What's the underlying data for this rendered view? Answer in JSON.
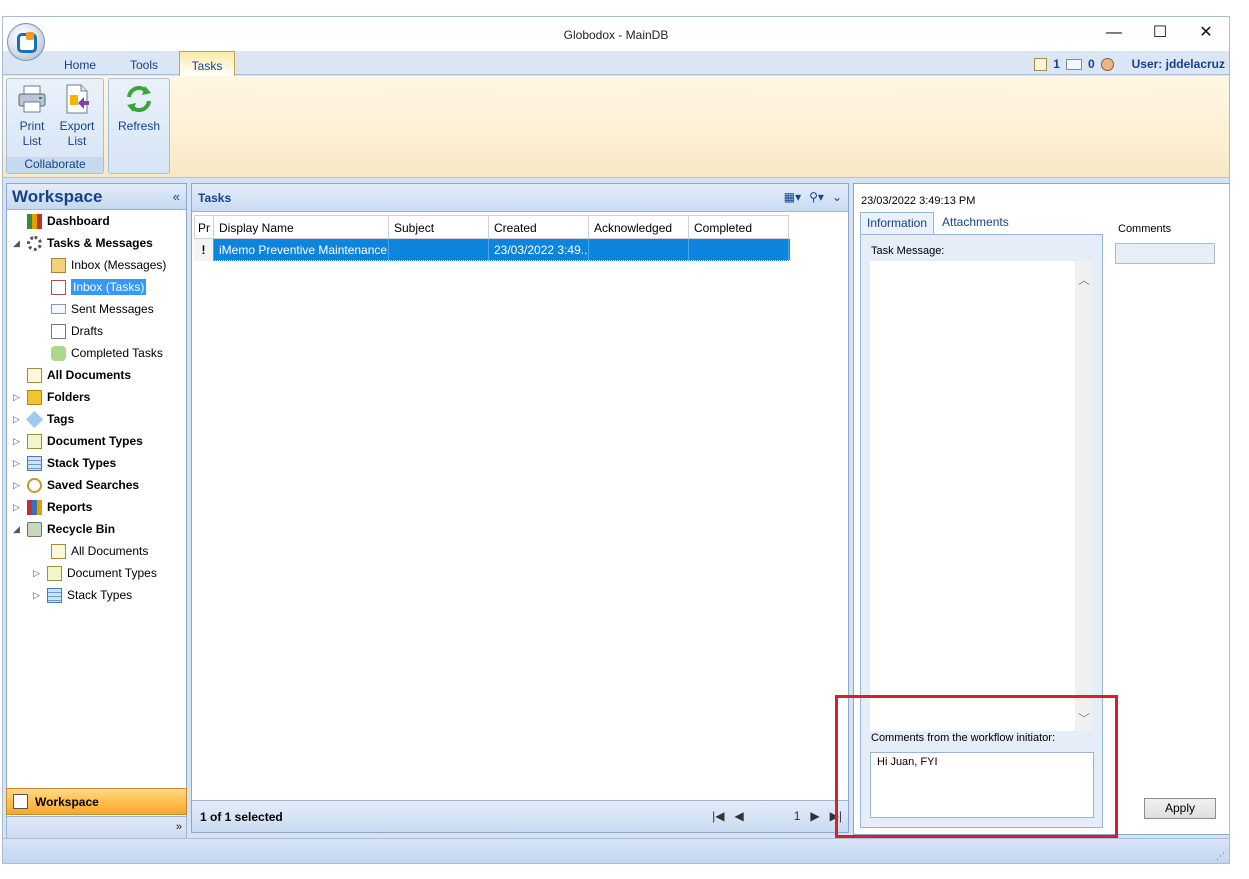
{
  "window": {
    "title": "Globodox - MainDB"
  },
  "window_controls": {
    "minimize": "—",
    "maximize": "☐",
    "close": "✕"
  },
  "ribbon_tabs": [
    {
      "label": "Home"
    },
    {
      "label": "Tools"
    },
    {
      "label": "Tasks"
    }
  ],
  "status_right": {
    "tasks_count": "1",
    "messages_count": "0",
    "user": "User: jddelacruz"
  },
  "ribbon": {
    "group_collaborate": {
      "label": "Collaborate",
      "print_label": "Print List",
      "export_label": "Export List"
    },
    "refresh_label": "Refresh"
  },
  "workspace": {
    "title": "Workspace",
    "collapse": "«",
    "tree": [
      {
        "label": "Dashboard"
      },
      {
        "label": "Tasks & Messages"
      },
      {
        "label": "Inbox (Messages)"
      },
      {
        "label": "Inbox (Tasks)"
      },
      {
        "label": "Sent Messages"
      },
      {
        "label": "Drafts"
      },
      {
        "label": "Completed Tasks"
      },
      {
        "label": "All Documents"
      },
      {
        "label": "Folders"
      },
      {
        "label": "Tags"
      },
      {
        "label": "Document Types"
      },
      {
        "label": "Stack Types"
      },
      {
        "label": "Saved Searches"
      },
      {
        "label": "Reports"
      },
      {
        "label": "Recycle Bin"
      },
      {
        "label": "All Documents"
      },
      {
        "label": "Document Types"
      },
      {
        "label": "Stack Types"
      }
    ],
    "nav_button": "Workspace",
    "more": "»"
  },
  "tasks": {
    "title": "Tasks",
    "columns": [
      "Pr",
      "Display Name",
      "Subject",
      "Created",
      "Acknowledged",
      "Completed"
    ],
    "rows": [
      {
        "priority": "!",
        "display_name": "iMemo Preventive Maintenance",
        "subject": "",
        "created": "23/03/2022  3:49...",
        "acknowledged": "",
        "completed": ""
      }
    ],
    "footer_selection": "1 of 1 selected",
    "page": "1"
  },
  "detail": {
    "timestamp": "23/03/2022 3:49:13 PM",
    "tabs": [
      {
        "label": "Information"
      },
      {
        "label": "Attachments"
      }
    ],
    "task_message_label": "Task Message:",
    "initiator_comments_label": "Comments from the workflow initiator:",
    "initiator_comments": "Hi Juan, FYI",
    "comments_label": "Comments",
    "comments_value": "",
    "apply_label": "Apply"
  },
  "colors": {
    "accent": "#15428b",
    "selection": "#0d84de",
    "highlight": "#d8202c"
  }
}
